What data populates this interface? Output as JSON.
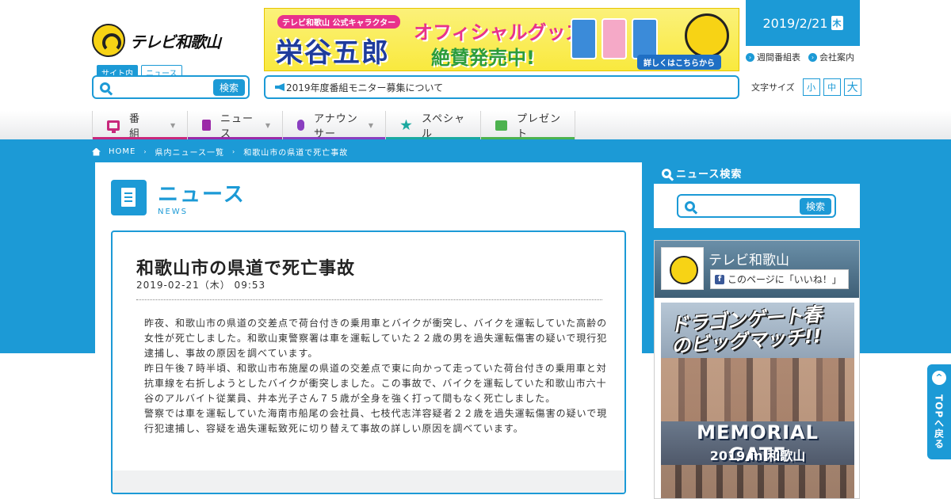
{
  "header": {
    "logo_text": "テレビ和歌山",
    "search_tabs": [
      "サイト内",
      "ニュース"
    ],
    "search_button": "検索",
    "date": "2019/2/21",
    "weekday": "木",
    "links": [
      "週間番組表",
      "会社案内"
    ],
    "notice": "2019年度番組モニター募集について",
    "font_size_label": "文字サイズ",
    "font_sizes": [
      "小",
      "中",
      "大"
    ]
  },
  "banner": {
    "sub": "テレビ和歌山 公式キャラクター",
    "name": "栄谷五郎",
    "goods": "オフィシャルグッズ",
    "sale": "絶賛発売中!",
    "link": "詳しくはこちらから"
  },
  "nav": {
    "items": [
      {
        "label": "番　組",
        "color": "#c8287c"
      },
      {
        "label": "ニュース",
        "color": "#9b2aa8"
      },
      {
        "label": "アナウンサー",
        "color": "#8a3fc0"
      },
      {
        "label": "スペシャル",
        "color": "#1aa9a0"
      },
      {
        "label": "プレゼント",
        "color": "#4db24f"
      }
    ]
  },
  "breadcrumb": [
    "HOME",
    "県内ニュース一覧",
    "和歌山市の県道で死亡事故"
  ],
  "section": {
    "title_jp": "ニュース",
    "title_en": "NEWS"
  },
  "article": {
    "title": "和歌山市の県道で死亡事故",
    "date": "2019-02-21（木） 09:53",
    "paragraphs": [
      "昨夜、和歌山市の県道の交差点で荷台付きの乗用車とバイクが衝突し、バイクを運転していた高齢の女性が死亡しました。和歌山東警察署は車を運転していた２２歳の男を過失運転傷害の疑いで現行犯逮捕し、事故の原因を調べています。",
      "昨日午後７時半頃、和歌山市布施屋の県道の交差点で東に向かって走っていた荷台付きの乗用車と対抗車線を右折しようとしたバイクが衝突しました。この事故で、バイクを運転していた和歌山市六十谷のアルバイト従業員、井本光子さん７５歳が全身を強く打って間もなく死亡しました。",
      "警察では車を運転していた海南市船尾の会社員、七枝代志洋容疑者２２歳を過失運転傷害の疑いで現行犯逮捕し、容疑を過失運転致死に切り替えて事故の詳しい原因を調べています。"
    ]
  },
  "sidebar": {
    "search_title": "ニュース検索",
    "search_button": "検索",
    "fb_name": "テレビ和歌山",
    "fb_like": "このページに「いいね！」",
    "poster_title": "ドラゴンゲート春のビッグマッチ!!",
    "poster_event": "MEMORIAL GATE",
    "poster_sub": "2019 in 和歌山"
  },
  "to_top": {
    "label": "TOPへ戻る"
  },
  "colors": {
    "accent": "#1c9ad6"
  }
}
